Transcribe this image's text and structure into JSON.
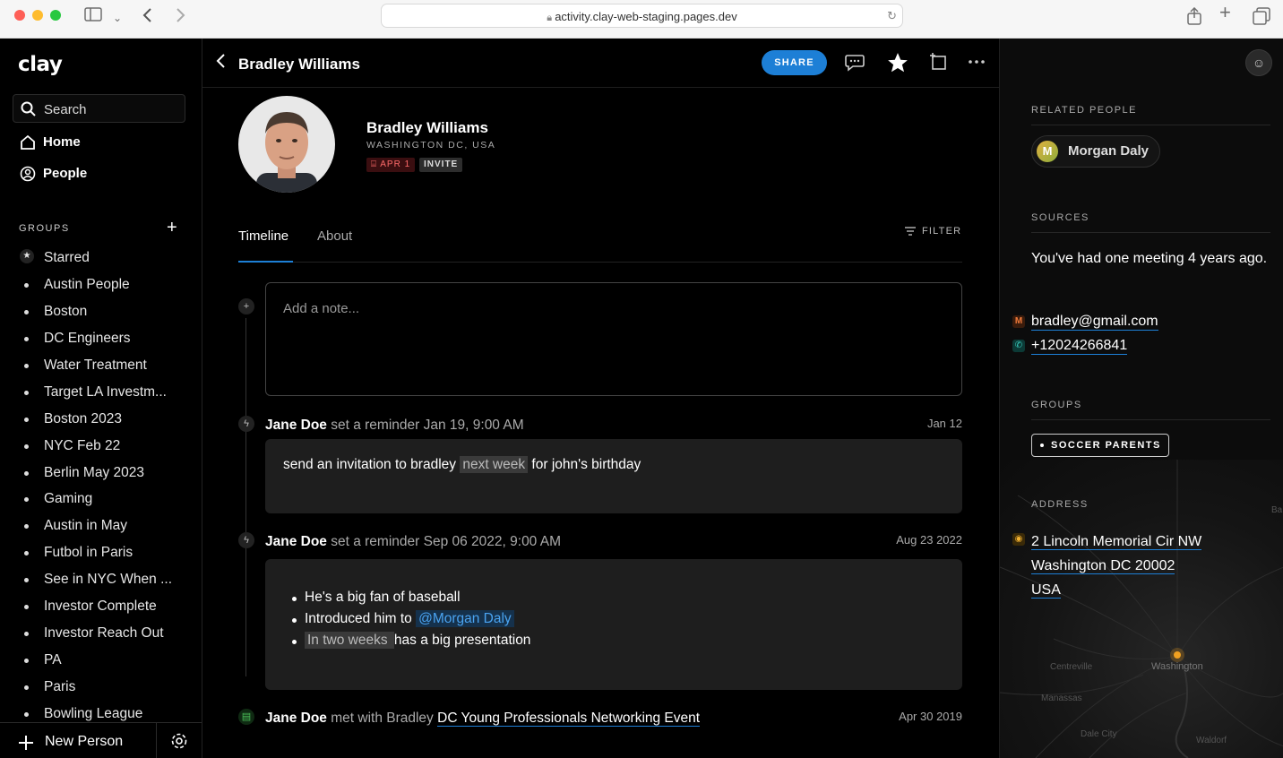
{
  "browser": {
    "url": "activity.clay-web-staging.pages.dev"
  },
  "sidebar": {
    "logo": "clay",
    "search_label": "Search",
    "nav": [
      {
        "label": "Home"
      },
      {
        "label": "People"
      }
    ],
    "groups_heading": "GROUPS",
    "groups": [
      {
        "label": "Starred"
      },
      {
        "label": "Austin People"
      },
      {
        "label": "Boston"
      },
      {
        "label": "DC Engineers"
      },
      {
        "label": "Water Treatment"
      },
      {
        "label": "Target LA Investm..."
      },
      {
        "label": "Boston 2023"
      },
      {
        "label": "NYC Feb 22"
      },
      {
        "label": "Berlin May 2023"
      },
      {
        "label": "Gaming"
      },
      {
        "label": "Austin in May"
      },
      {
        "label": "Futbol in Paris"
      },
      {
        "label": "See in NYC When ..."
      },
      {
        "label": "Investor Complete"
      },
      {
        "label": "Investor Reach Out"
      },
      {
        "label": "PA"
      },
      {
        "label": "Paris"
      },
      {
        "label": "Bowling League"
      }
    ],
    "new_person_label": "New Person"
  },
  "header": {
    "title": "Bradley Williams",
    "share_label": "SHARE"
  },
  "profile": {
    "name": "Bradley Williams",
    "location": "WASHINGTON DC, USA",
    "birthday_badge": "APR 1",
    "invite_badge": "INVITE"
  },
  "tabs": [
    {
      "label": "Timeline"
    },
    {
      "label": "About"
    }
  ],
  "filter_label": "FILTER",
  "note_placeholder": "Add a note...",
  "timeline": [
    {
      "who": "Jane Doe",
      "what": "set a reminder Jan 19, 9:00 AM",
      "date": "Jan 12",
      "body": {
        "pre": "send an invitation to bradley ",
        "highlight": "next week",
        "post": " for john's birthday"
      }
    },
    {
      "who": "Jane Doe",
      "what": "set a reminder Sep 06 2022, 9:00 AM",
      "date": "Aug 23 2022",
      "bullets": {
        "b1": "He's a big fan of baseball",
        "b2_pre": "Introduced him to ",
        "b2_mention": "@Morgan Daly",
        "b3_highlight": "In two weeks ",
        "b3_post": "has a big presentation"
      }
    },
    {
      "who": "Jane Doe",
      "what": "met with Bradley",
      "link": "DC Young Professionals Networking Event",
      "date": "Apr 30 2019"
    }
  ],
  "right": {
    "related_heading": "RELATED PEOPLE",
    "related_person": "Morgan Daly",
    "related_initial": "M",
    "sources_heading": "SOURCES",
    "sources_text": "You've had one meeting 4 years ago.",
    "email": "bradley@gmail.com",
    "phone": "+12024266841",
    "groups_heading": "GROUPS",
    "group_tag": "SOCCER PARENTS",
    "address_heading": "ADDRESS",
    "address_lines": [
      "2 Lincoln Memorial Cir NW",
      "Washington DC 20002",
      "USA"
    ],
    "map_labels": [
      "Centreville",
      "Washington",
      "Manassas",
      "Dale City",
      "Waldorf",
      "Ba"
    ]
  }
}
